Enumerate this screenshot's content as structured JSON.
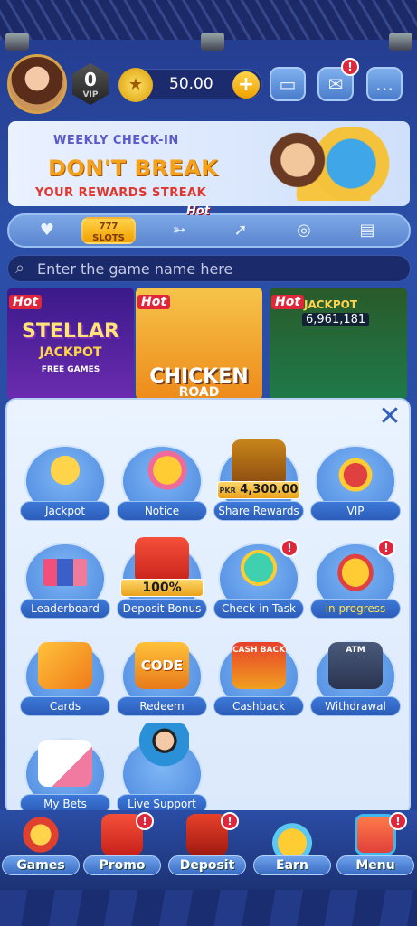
{
  "header": {
    "vip_level": "0",
    "vip_label": "VIP",
    "balance": "50.00",
    "plus_label": "+",
    "mail_badge": "!"
  },
  "banner": {
    "line1": "WEEKLY CHECK-IN",
    "line2": "DON'T BREAK",
    "line3": "YOUR REWARDS STREAK"
  },
  "categories": {
    "hot_tag": "Hot",
    "slots_label": "SLOTS"
  },
  "search": {
    "placeholder": "Enter the game name here"
  },
  "games": {
    "hot_label": "Hot",
    "stellar_title": "STELLAR",
    "stellar_sub": "JACKPOT",
    "free_games": "FREE GAMES",
    "chicken_title": "CHICKEN",
    "chicken_sub": "ROAD",
    "jackpot_label": "JACKPOT",
    "jackpot_value": "6,961,181"
  },
  "menu_panel": {
    "close_label": "✕",
    "tiles": [
      {
        "label": "Jackpot"
      },
      {
        "label": "Notice"
      },
      {
        "label": "Share Rewards",
        "pkr_currency": "PKR",
        "pkr_amount": "4,300.00"
      },
      {
        "label": "VIP"
      },
      {
        "label": "Leaderboard"
      },
      {
        "label": "Deposit Bonus",
        "overlay": "100%"
      },
      {
        "label": "Check-in Task",
        "badge": "!"
      },
      {
        "label": "in progress",
        "badge": "!"
      },
      {
        "label": "Cards"
      },
      {
        "label": "Redeem",
        "overlay": "CODE"
      },
      {
        "label": "Cashback",
        "overlay": "CASH BACK"
      },
      {
        "label": "Withdrawal",
        "overlay": "ATM"
      },
      {
        "label": "My Bets"
      },
      {
        "label": "Live Support"
      }
    ]
  },
  "bottom_nav": {
    "items": [
      {
        "label": "Games"
      },
      {
        "label": "Promo",
        "badge": "!"
      },
      {
        "label": "Deposit",
        "badge": "!"
      },
      {
        "label": "Earn"
      },
      {
        "label": "Menu",
        "badge": "!"
      }
    ]
  }
}
